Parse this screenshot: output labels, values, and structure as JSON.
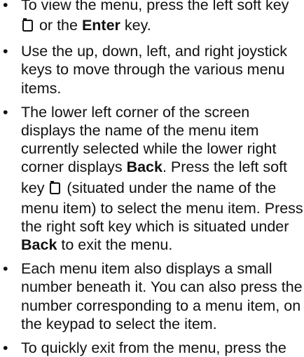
{
  "items": [
    {
      "line1": "To view the menu, press the left soft key",
      "line2_after_icon": " or the ",
      "line2_bold": "Enter",
      "line2_end": " key."
    },
    {
      "line1": "Use the up, down, left, and right joystick",
      "line2": "keys to move through the various menu",
      "line3": "items."
    },
    {
      "line1": "The lower left corner of the screen",
      "line2": "displays the name of the menu item",
      "line3": "currently selected while the lower right",
      "line4_start": "corner displays ",
      "line4_bold": "Back",
      "line4_end": ". Press the left soft",
      "line5_start": "key ",
      "line5_end": " (situated under the name of the",
      "line6": "menu item) to select the menu item. Press",
      "line7": "the right soft key which is situated under",
      "line8_bold": "Back",
      "line8_end": " to exit the menu."
    },
    {
      "line1": "Each menu item also displays a small",
      "line2": "number beneath it. You can also press the",
      "line3": "number corresponding to a menu item, on",
      "line4": "the keypad to select the item."
    },
    {
      "line1": "To quickly exit from the menu, press the"
    }
  ],
  "bullet_glyph": "•",
  "icons": {
    "softkey": "left-soft-key-icon"
  }
}
